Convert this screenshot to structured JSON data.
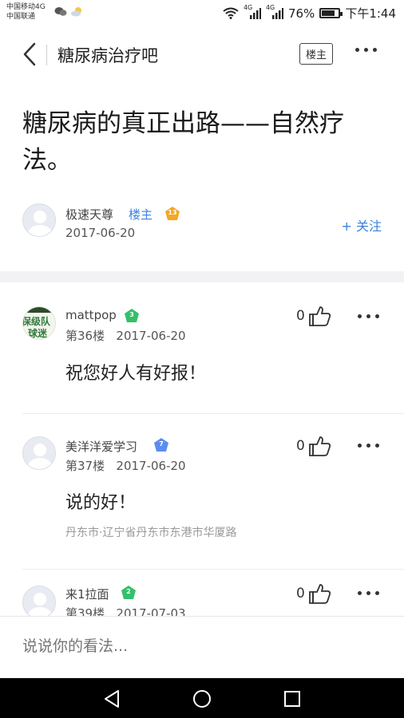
{
  "status_bar": {
    "carrier_line1": "中国移动4G",
    "carrier_line2": "中国联通",
    "network_1": "4G",
    "network_2": "4G",
    "battery_percent": "76%",
    "battery_level": 0.76,
    "time": "下午1:44"
  },
  "nav": {
    "forum_title": "糖尿病治疗吧",
    "owner_only_label": "楼主"
  },
  "post": {
    "title": "糖尿病的真正出路——自然疗法。",
    "author": {
      "name": "极速天尊",
      "owner_tag": "楼主",
      "level": "13",
      "date": "2017-06-20"
    },
    "follow_label": "+ 关注"
  },
  "replies": [
    {
      "user": "mattpop",
      "level": "3",
      "floor": "第36楼",
      "date": "2017-06-20",
      "likes": "0",
      "content": "祝您好人有好报！",
      "avatar_text_1": "保级队",
      "avatar_text_2": "球迷"
    },
    {
      "user": "美洋洋爱学习",
      "level": "7",
      "floor": "第37楼",
      "date": "2017-06-20",
      "likes": "0",
      "content": "说的好！",
      "location": "丹东市·辽宁省丹东市东港市华厦路"
    },
    {
      "user": "来1拉面",
      "level": "2",
      "floor": "第39楼",
      "date": "2017-07-03",
      "likes": "0"
    }
  ],
  "comment_bar": {
    "placeholder": "说说你的看法..."
  },
  "colors": {
    "accent_blue": "#3b82e0",
    "badge_orange": "#f5a623",
    "badge_green": "#34c06a",
    "badge_blue": "#5b8def"
  }
}
